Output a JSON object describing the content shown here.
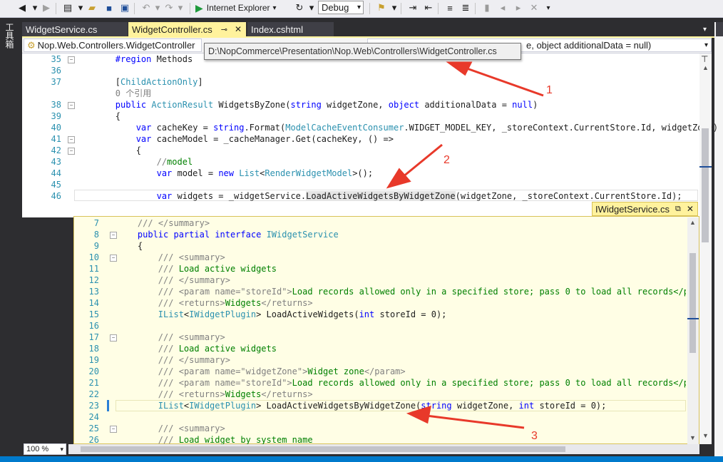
{
  "toolbar": {
    "browser_label": "Internet Explorer",
    "config_value": "Debug"
  },
  "toolbox": {
    "label": "工具箱"
  },
  "tabs": [
    {
      "label": "WidgetService.cs"
    },
    {
      "label": "WidgetController.cs"
    },
    {
      "label": "Index.cshtml"
    }
  ],
  "navbar": {
    "class_dropdown": "Nop.Web.Controllers.WidgetController",
    "member_dropdown": "e, object additionalData = null)"
  },
  "tooltip": {
    "path": "D:\\NopCommerce\\Presentation\\Nop.Web\\Controllers\\WidgetController.cs"
  },
  "editor": {
    "line_numbers": [
      "35",
      "36",
      "37",
      "38",
      "39",
      "40",
      "41",
      "42",
      "43",
      "44",
      "45",
      "46"
    ],
    "lines": [
      "        #region Methods",
      "",
      "        [ChildActionOnly]",
      "        0 个引用",
      "        public ActionResult WidgetsByZone(string widgetZone, object additionalData = null)",
      "        {",
      "            var cacheKey = string.Format(ModelCacheEventConsumer.WIDGET_MODEL_KEY, _storeContext.CurrentStore.Id, widgetZone)",
      "            var cacheModel = _cacheManager.Get(cacheKey, () =>",
      "            {",
      "                //model",
      "                var model = new List<RenderWidgetModel>();",
      "",
      "                var widgets = _widgetService.LoadActiveWidgetsByWidgetZone(widgetZone, _storeContext.CurrentStore.Id);"
    ]
  },
  "peek": {
    "file_label": "IWidgetService.cs",
    "line_numbers": [
      "7",
      "8",
      "9",
      "10",
      "11",
      "12",
      "13",
      "14",
      "15",
      "16",
      "17",
      "18",
      "19",
      "20",
      "21",
      "22",
      "23",
      "24",
      "25",
      "26"
    ],
    "lines": [
      "    /// </summary>",
      "    public partial interface IWidgetService",
      "    {",
      "        /// <summary>",
      "        /// Load active widgets",
      "        /// </summary>",
      "        /// <param name=\"storeId\">Load records allowed only in a specified store; pass 0 to load all records</para",
      "        /// <returns>Widgets</returns>",
      "        IList<IWidgetPlugin> LoadActiveWidgets(int storeId = 0);",
      "",
      "        /// <summary>",
      "        /// Load active widgets",
      "        /// </summary>",
      "        /// <param name=\"widgetZone\">Widget zone</param>",
      "        /// <param name=\"storeId\">Load records allowed only in a specified store; pass 0 to load all records</para",
      "        /// <returns>Widgets</returns>",
      "        IList<IWidgetPlugin> LoadActiveWidgetsByWidgetZone(string widgetZone, int storeId = 0);",
      "",
      "        /// <summary>",
      "        /// Load widget by system name"
    ]
  },
  "zoom": {
    "value": "100 %"
  },
  "annotations": [
    {
      "label": "1"
    },
    {
      "label": "2"
    },
    {
      "label": "3"
    }
  ],
  "colors": {
    "accent": "#007acc",
    "active_tab": "#fff29d",
    "peek_bg": "#fffee5",
    "arrow": "#e8392a"
  }
}
